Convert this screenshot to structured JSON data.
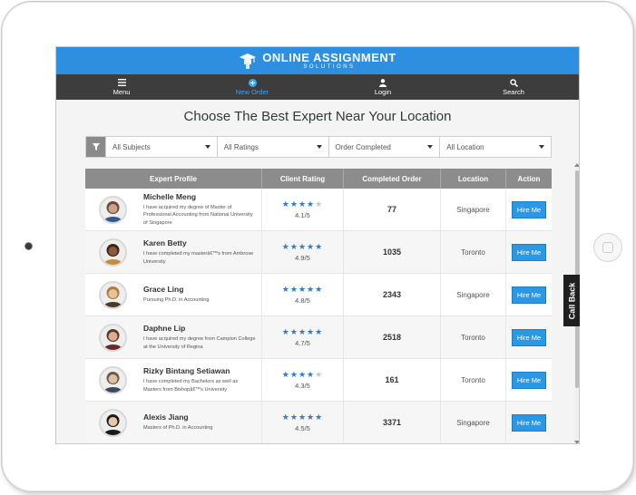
{
  "brand": {
    "name": "ONLINE ASSIGNMENT",
    "tagline": "SOLUTIONS",
    "color": "#2e8fe0"
  },
  "nav": [
    {
      "label": "Menu",
      "icon": "menu-icon",
      "active": false
    },
    {
      "label": "New Order",
      "icon": "plus-circle-icon",
      "active": true
    },
    {
      "label": "Login",
      "icon": "user-icon",
      "active": false
    },
    {
      "label": "Search",
      "icon": "search-icon",
      "active": false
    }
  ],
  "page": {
    "title": "Choose The Best Expert Near Your Location"
  },
  "filters": [
    "All Subjects",
    "All Ratings",
    "Order Completed",
    "All Location"
  ],
  "table": {
    "headers": [
      "Expert Profile",
      "Client Rating",
      "Completed Order",
      "Location",
      "Action"
    ],
    "rows": [
      {
        "name": "Michelle Meng",
        "desc": "I have acquired my degree of Master of Professional Accounting from National University of Singapore",
        "stars": 4,
        "rating": "4.1/5",
        "orders": "77",
        "location": "Singapore",
        "action": "Hire Me"
      },
      {
        "name": "Karen Betty",
        "desc": "I have completed my masterâ€™s from Ambrose University",
        "stars": 5,
        "rating": "4.9/5",
        "orders": "1035",
        "location": "Toronto",
        "action": "Hire Me"
      },
      {
        "name": "Grace Ling",
        "desc": "Pursuing Ph.D. in Accounting",
        "stars": 5,
        "rating": "4.8/5",
        "orders": "2343",
        "location": "Singapore",
        "action": "Hire Me"
      },
      {
        "name": "Daphne Lip",
        "desc": "I have acquired my degree from Campion College at the University of Regina",
        "stars": 5,
        "rating": "4.7/5",
        "orders": "2518",
        "location": "Toronto",
        "action": "Hire Me"
      },
      {
        "name": "Rizky Bintang Setiawan",
        "desc": "I have completed my Bachelors as well as Masters from Bishopâ€™s University",
        "stars": 4,
        "rating": "4.3/5",
        "orders": "161",
        "location": "Toronto",
        "action": "Hire Me"
      },
      {
        "name": "Alexis Jiang",
        "desc": "Masters of Ph.D. in Accounting",
        "stars": 5,
        "rating": "4.5/5",
        "orders": "3371",
        "location": "Singapore",
        "action": "Hire Me"
      }
    ]
  },
  "callback": {
    "label": "Call Back"
  }
}
